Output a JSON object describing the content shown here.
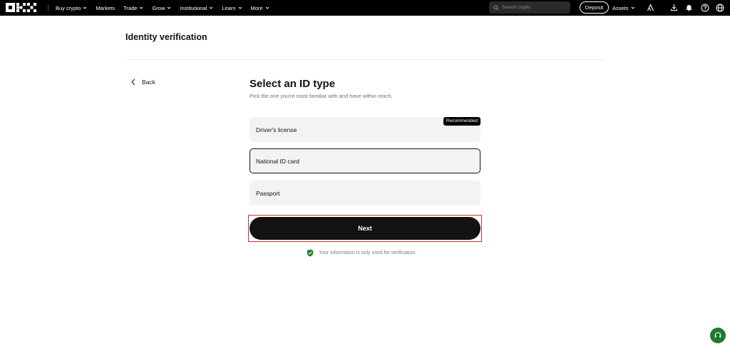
{
  "nav": {
    "items": [
      {
        "label": "Buy crypto",
        "dropdown": true
      },
      {
        "label": "Markets",
        "dropdown": false
      },
      {
        "label": "Trade",
        "dropdown": true
      },
      {
        "label": "Grow",
        "dropdown": true
      },
      {
        "label": "Institutional",
        "dropdown": true
      },
      {
        "label": "Learn",
        "dropdown": true
      },
      {
        "label": "More",
        "dropdown": true
      }
    ],
    "search_placeholder": "Search crypto",
    "deposit_label": "Deposit",
    "assets_label": "Assets"
  },
  "page": {
    "title": "Identity verification",
    "back_label": "Back",
    "heading": "Select an ID type",
    "subheading": "Pick the one you're most familiar with and have within reach.",
    "options": [
      {
        "label": "Driver's license",
        "badge": "Recommended",
        "selected": false
      },
      {
        "label": "National ID card",
        "badge": "",
        "selected": true
      },
      {
        "label": "Passport",
        "badge": "",
        "selected": false
      }
    ],
    "next_label": "Next",
    "privacy_note": "Your information is only used for verification."
  },
  "colors": {
    "nav_bg": "#000000",
    "primary_button": "#121212",
    "option_bg": "#f3f3f3",
    "highlight_outline": "#d32f2f",
    "shield_green": "#2e7d32",
    "support_green": "#1f7a2e"
  },
  "icons": [
    "okx-logo",
    "chevron-down-icon",
    "search-icon",
    "user-icon",
    "download-icon",
    "bell-icon",
    "help-icon",
    "globe-icon",
    "chevron-left-icon",
    "shield-check-icon",
    "support-chat-icon"
  ]
}
